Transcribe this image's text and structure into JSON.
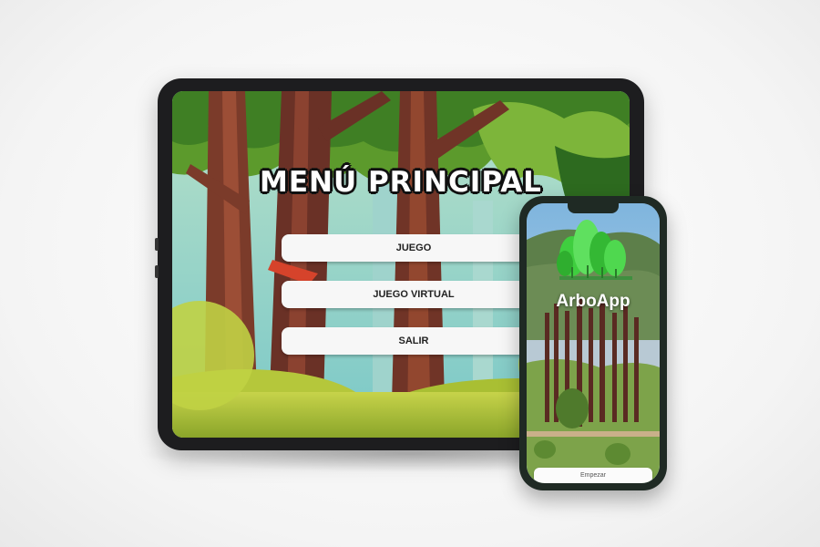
{
  "tablet": {
    "title": "MENÚ PRINCIPAL",
    "buttons": [
      "JUEGO",
      "JUEGO VIRTUAL",
      "SALIR"
    ]
  },
  "phone": {
    "app_name": "ArboApp",
    "start_label": "Empezar"
  },
  "colors": {
    "tablet_frame": "#1d1d1f",
    "phone_frame": "#1f2a24",
    "button_bg": "#f7f7f7",
    "logo_green": "#3fce3f"
  },
  "icons": [
    "tree-logo-icon"
  ]
}
